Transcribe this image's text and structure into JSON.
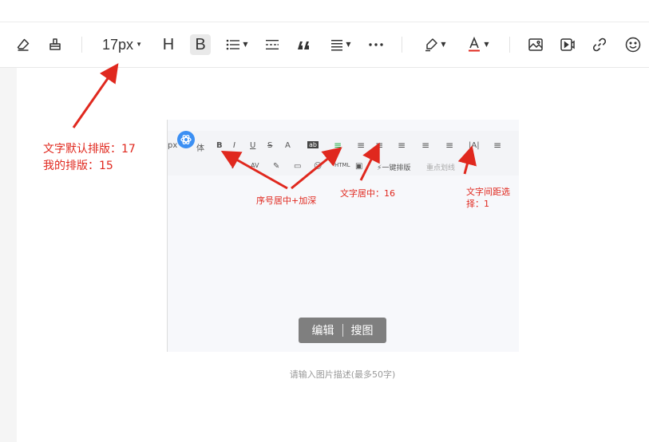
{
  "toolbar": {
    "font_size_value": "17px",
    "heading_label": "H",
    "bold_label": "B",
    "tools": [
      {
        "name": "eraser-icon"
      },
      {
        "name": "format-painter-icon"
      },
      {
        "name": "font-size-dropdown"
      },
      {
        "name": "heading-button"
      },
      {
        "name": "bold-button"
      },
      {
        "name": "list-dropdown"
      },
      {
        "name": "divider-icon"
      },
      {
        "name": "quote-icon"
      },
      {
        "name": "align-dropdown"
      },
      {
        "name": "more-icon"
      },
      {
        "name": "highlight-dropdown"
      },
      {
        "name": "font-color-dropdown"
      },
      {
        "name": "image-icon"
      },
      {
        "name": "video-icon"
      },
      {
        "name": "link-icon"
      },
      {
        "name": "emoji-icon"
      }
    ]
  },
  "annotation": {
    "line1": "文字默认排版：17",
    "line2": "我的排版：15"
  },
  "embedded_screenshot": {
    "toolbar_row1": {
      "px": "px",
      "font": "体",
      "bold": "B",
      "italic": "I",
      "underline": "U",
      "strike": "S",
      "fontA": "A",
      "ab": "ab"
    },
    "toolbar_row2": {
      "onekey": "一键排版",
      "keyline": "重点划线"
    },
    "notes": {
      "serial": "序号居中+加深",
      "center": "文字居中：16",
      "spacing_line1": "文字间距选",
      "spacing_line2": "择：1"
    },
    "edit_button": "编辑",
    "search_image_button": "搜图"
  },
  "caption_placeholder": "请输入图片描述(最多50字)"
}
